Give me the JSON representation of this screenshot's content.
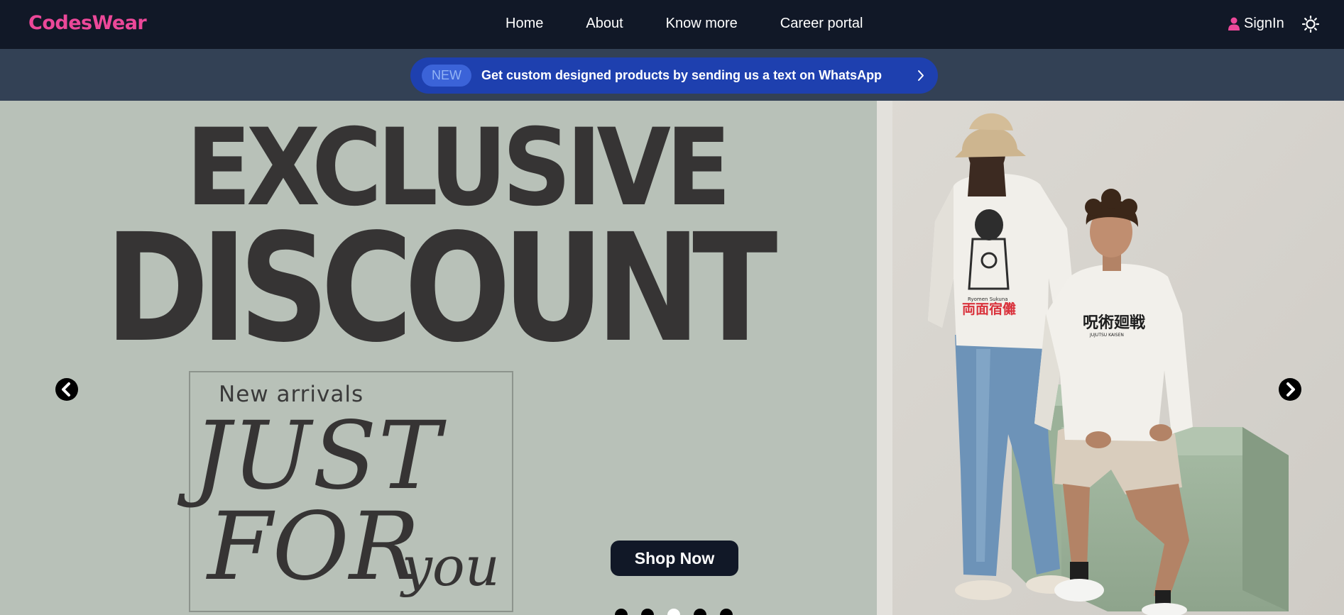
{
  "navbar": {
    "brand": "CodesWear",
    "links": [
      "Home",
      "About",
      "Know more",
      "Career portal"
    ],
    "signin_label": "SignIn"
  },
  "banner": {
    "badge": "NEW",
    "text": "Get custom designed products by sending us a text on WhatsApp"
  },
  "hero": {
    "headline_line1": "EXCLUSIVE",
    "headline_line2": "DISCOUNT",
    "arrivals_title": "New arrivals",
    "script_line1": "JUST",
    "script_line2": "FOR",
    "script_line3": "you",
    "shop_button": "Shop Now",
    "sweatshirt_back_text": "Ryomen Sukuna",
    "sweatshirt_kanji": "両面宿儺",
    "sweatshirt_front_kanji": "呪術廻戦",
    "sweatshirt_front_text": "JUJUTSU KAISEN",
    "slides_total": 5,
    "active_slide": 3
  },
  "colors": {
    "nav_bg": "#111827",
    "brand": "#ec4899",
    "banner_bg": "#334155",
    "pill_bg": "#1e40af",
    "hero_bg": "#b8c1b8",
    "headline": "#363434",
    "shop_button_bg": "#111827",
    "cube": "#9fb59d"
  },
  "icons": [
    "user-icon",
    "sun-icon",
    "chevron-right-icon",
    "arrow-left-circle-icon",
    "arrow-right-circle-icon"
  ]
}
